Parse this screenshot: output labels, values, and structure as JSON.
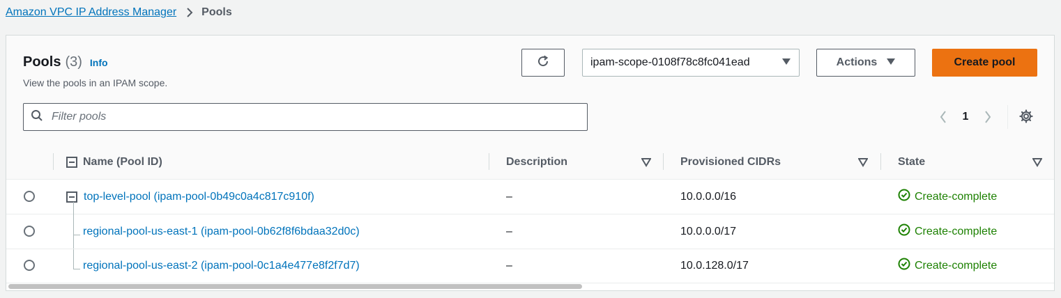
{
  "breadcrumb": {
    "root": "Amazon VPC IP Address Manager",
    "current": "Pools"
  },
  "panel": {
    "title": "Pools",
    "count": "(3)",
    "info": "Info",
    "description": "View the pools in an IPAM scope."
  },
  "toolbar": {
    "refresh_icon": "refresh-icon",
    "scope_value": "ipam-scope-0108f78c8fc041ead",
    "actions_label": "Actions",
    "create_label": "Create pool"
  },
  "filter": {
    "placeholder": "Filter pools",
    "value": ""
  },
  "pagination": {
    "current_page": "1"
  },
  "table": {
    "columns": [
      "Name (Pool ID)",
      "Description",
      "Provisioned CIDRs",
      "State"
    ],
    "rows": [
      {
        "name": "top-level-pool (ipam-pool-0b49c0a4c817c910f)",
        "description": "–",
        "cidr": "10.0.0.0/16",
        "state": "Create-complete",
        "level": 0
      },
      {
        "name": "regional-pool-us-east-1 (ipam-pool-0b62f8f6bdaa32d0c)",
        "description": "–",
        "cidr": "10.0.0.0/17",
        "state": "Create-complete",
        "level": 1
      },
      {
        "name": "regional-pool-us-east-2 (ipam-pool-0c1a4e477e8f2f7d7)",
        "description": "–",
        "cidr": "10.0.128.0/17",
        "state": "Create-complete",
        "level": 1
      }
    ]
  },
  "colors": {
    "link": "#0073bb",
    "primary_button": "#ec7211",
    "success": "#1d8102",
    "background": "#f2f3f3"
  }
}
